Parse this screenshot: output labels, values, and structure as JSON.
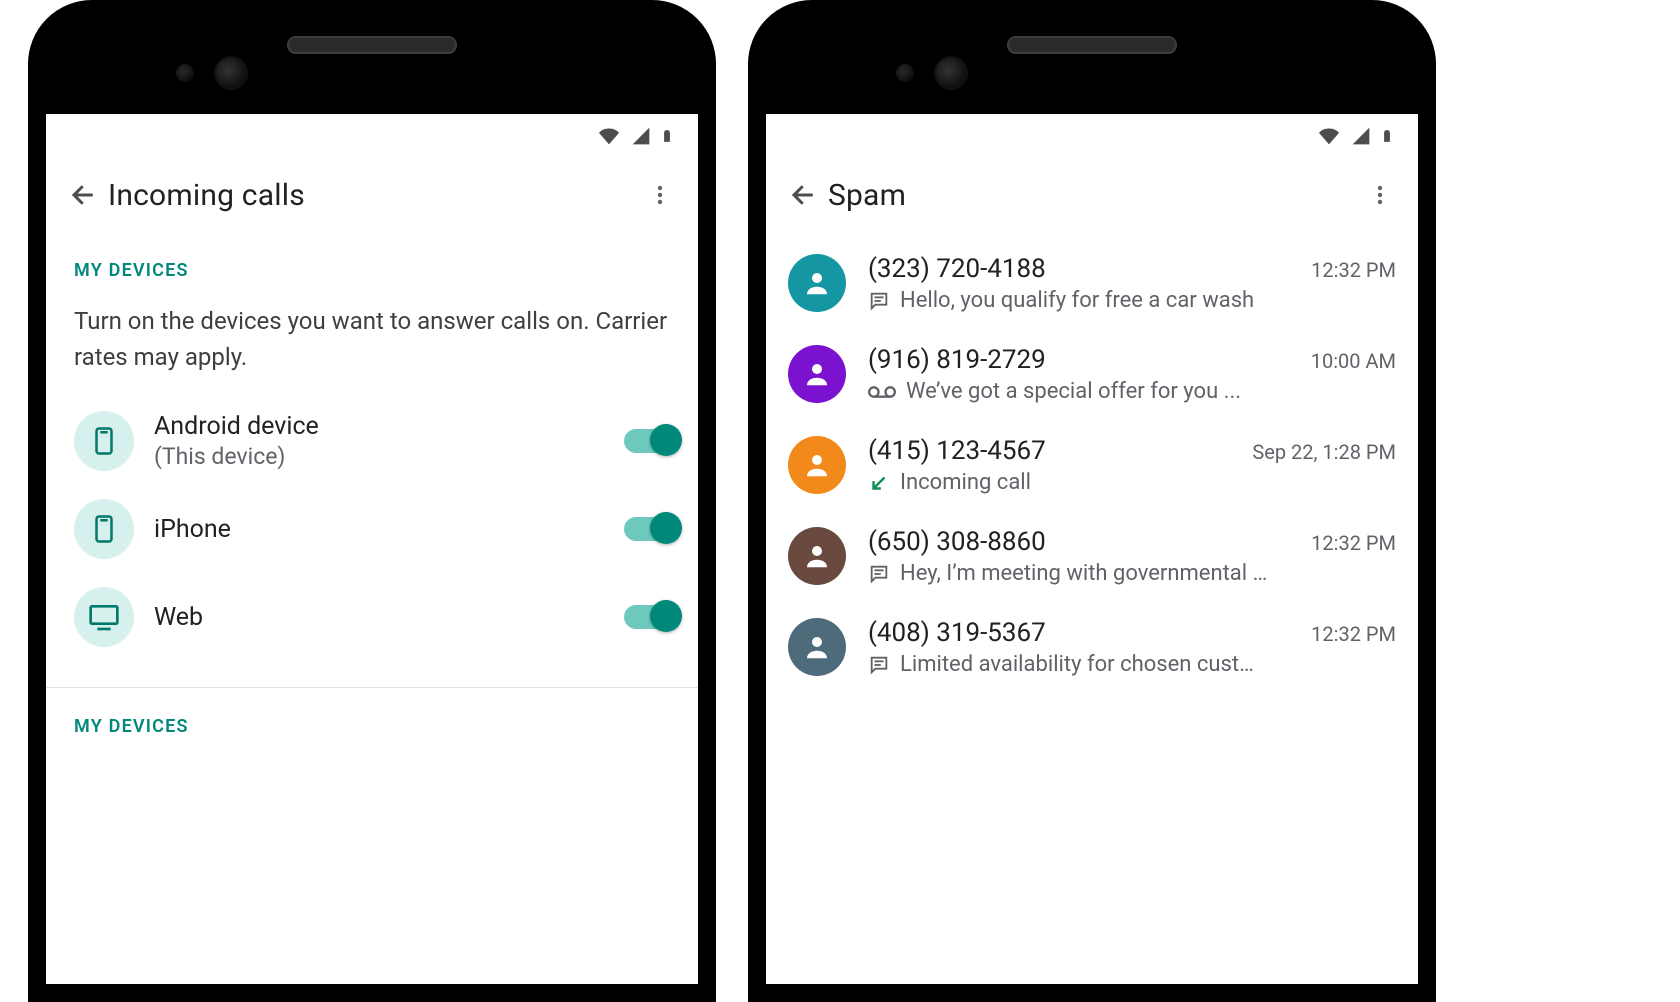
{
  "left": {
    "title": "Incoming calls",
    "section_label": "MY DEVICES",
    "section_desc": "Turn on the devices you want to answer calls on. Carrier rates may apply.",
    "devices": [
      {
        "name": "Android device",
        "sub": "(This device)",
        "icon": "phone-portrait",
        "on": true
      },
      {
        "name": "iPhone",
        "sub": "",
        "icon": "phone-portrait",
        "on": true
      },
      {
        "name": "Web",
        "sub": "",
        "icon": "desktop",
        "on": true
      }
    ],
    "section_label_2": "MY DEVICES"
  },
  "right": {
    "title": "Spam",
    "items": [
      {
        "number": "(323) 720-4188",
        "time": "12:32 PM",
        "type": "msg",
        "text": "Hello, you qualify for free a car wash",
        "color": "#1496a3"
      },
      {
        "number": "(916) 819-2729",
        "time": "10:00 AM",
        "type": "vm",
        "text": "We’ve got a special offer for you ...",
        "color": "#7a12cf"
      },
      {
        "number": "(415) 123-4567",
        "time": "Sep 22, 1:28 PM",
        "type": "call",
        "text": "Incoming call",
        "color": "#f28a1b"
      },
      {
        "number": "(650) 308-8860",
        "time": "12:32 PM",
        "type": "msg",
        "text": "Hey, I’m meeting with governmental …",
        "color": "#6a4a3f"
      },
      {
        "number": "(408) 319-5367",
        "time": "12:32 PM",
        "type": "msg",
        "text": "Limited availability for chosen cust…",
        "color": "#4d6b7a"
      }
    ]
  }
}
